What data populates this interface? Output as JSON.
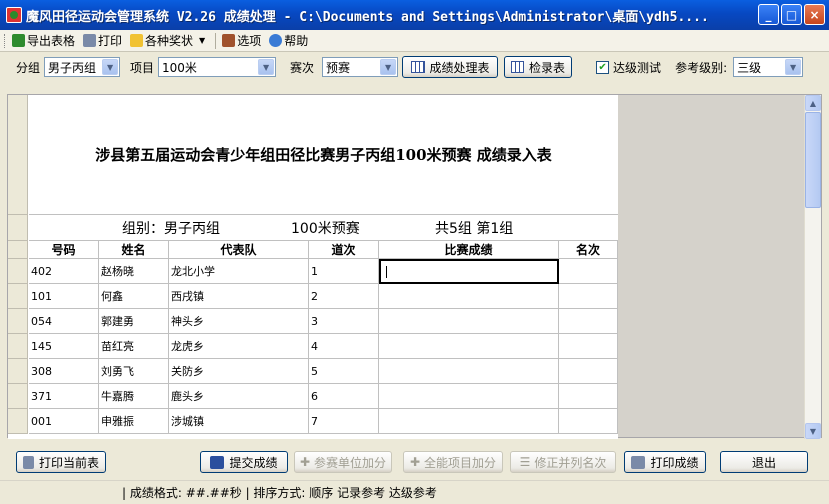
{
  "title": "魔风田径运动会管理系统 V2.26 成绩处理  - C:\\Documents and Settings\\Administrator\\桌面\\ydh5....",
  "menu": {
    "export": "导出表格",
    "print": "打印",
    "awards": "各种奖状",
    "options": "选项",
    "help": "帮助"
  },
  "filter": {
    "group_label": "分组",
    "group_value": "男子丙组",
    "event_label": "项目",
    "event_value": "100米",
    "round_label": "赛次",
    "round_value": "预赛",
    "process_btn": "成绩处理表",
    "check_btn": "检录表",
    "qual_test_label": "达级测试",
    "level_label": "参考级别:",
    "level_value": "三级"
  },
  "sheet": {
    "title": "涉县第五届运动会青少年组田径比赛男子丙组100米预赛 成绩录入表",
    "group_info": "组别：男子丙组",
    "round_info": "100米预赛",
    "heat_info": "共5组  第1组",
    "headers": [
      "号码",
      "姓名",
      "代表队",
      "道次",
      "比赛成绩",
      "名次"
    ],
    "rows": [
      [
        "402",
        "赵杨晓",
        "龙北小学",
        "1",
        "",
        ""
      ],
      [
        "101",
        "何鑫",
        "西戌镇",
        "2",
        "",
        ""
      ],
      [
        "054",
        "郭建勇",
        "神头乡",
        "3",
        "",
        ""
      ],
      [
        "145",
        "苗红亮",
        "龙虎乡",
        "4",
        "",
        ""
      ],
      [
        "308",
        "刘勇飞",
        "关防乡",
        "5",
        "",
        ""
      ],
      [
        "371",
        "牛嘉腾",
        "鹿头乡",
        "6",
        "",
        ""
      ],
      [
        "001",
        "申雅振",
        "涉城镇",
        "7",
        "",
        ""
      ]
    ]
  },
  "bottom": {
    "print_current": "打印当前表",
    "submit": "提交成绩",
    "unit_bonus": "参赛单位加分",
    "allround_bonus": "全能项目加分",
    "fix_rank": "修正并列名次",
    "print_result": "打印成绩",
    "exit": "退出"
  },
  "status": {
    "format": "| 成绩格式:  ##.##秒  |  排序方式:  顺序  记录参考  达级参考"
  }
}
